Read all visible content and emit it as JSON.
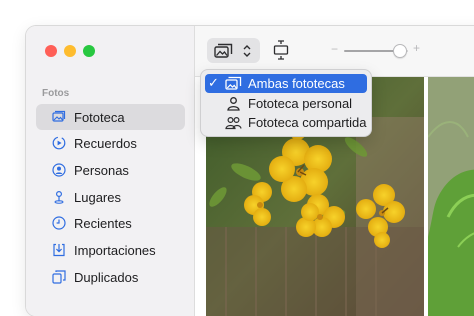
{
  "sidebar": {
    "section_label": "Fotos",
    "items": [
      {
        "label": "Fototeca",
        "icon": "photos-library-icon",
        "selected": true
      },
      {
        "label": "Recuerdos",
        "icon": "memories-play-icon"
      },
      {
        "label": "Personas",
        "icon": "person-circle-icon"
      },
      {
        "label": "Lugares",
        "icon": "map-pin-icon"
      },
      {
        "label": "Recientes",
        "icon": "clock-icon"
      },
      {
        "label": "Importaciones",
        "icon": "import-icon"
      },
      {
        "label": "Duplicados",
        "icon": "duplicates-icon"
      }
    ]
  },
  "toolbar": {
    "library_button_icon": "photos-library-icon",
    "chevron_icon": "chevron-up-down-icon",
    "fit_icon": "fit-frame-icon",
    "zoom_minus": "−",
    "zoom_plus": "+",
    "zoom_level": 0.9
  },
  "library_menu": {
    "items": [
      {
        "label": "Ambas fototecas",
        "icon": "photos-library-icon",
        "checked": true,
        "highlighted": true
      },
      {
        "label": "Fototeca personal",
        "icon": "person-icon"
      },
      {
        "label": "Fototeca compartida",
        "icon": "two-people-icon"
      }
    ],
    "check_mark": "✓"
  },
  "colors": {
    "accent": "#2f6de1",
    "sidebar_icon": "#2f6de1",
    "close": "#ff5f57",
    "minimize": "#febc2e",
    "zoom": "#28c840"
  }
}
